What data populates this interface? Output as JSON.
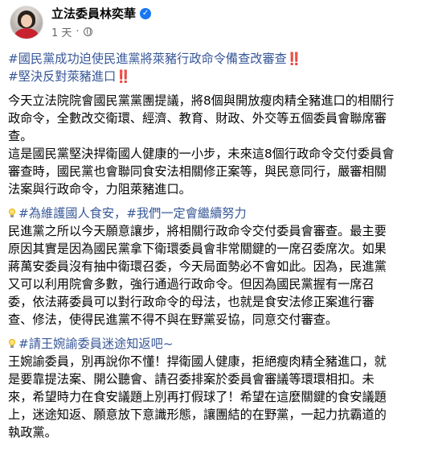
{
  "post": {
    "author": "立法委員林奕華",
    "time": "1 天",
    "dot": "·"
  },
  "content": {
    "hashtag1": "#國民黨成功迫使民進黨將萊豬行政命令備查改審查",
    "bang1": "‼️",
    "hashtag2": "#堅決反對萊豬進口",
    "bang2": "‼️",
    "p1": [
      "今天立法院院會國民黨黨團提議，將8個與開放瘦肉精全豬進口的相關行",
      "政命令，全數改交衛環、經濟、教育、財政、外交等五個委員會聯席審",
      "查。"
    ],
    "p2": [
      "這是國民黨堅決捍衛國人健康的一小步，未來這8個行政命令交付委員會",
      "審查時，國民黨也會聯同食安法相關修正案等，與民意同行，嚴審相關",
      "法案與行政命令，力阻萊豬進口。"
    ],
    "section1_tag": "#為維護國人食安，#我們一定會繼續努力",
    "p3": [
      "民進黨之所以今天願意讓步，將相關行政命令交付委員會審查。最主要",
      "原因其實是因為國民黨拿下衛環委員會非常關鍵的一席召委席次。如果",
      "蔣萬安委員沒有抽中衛環召委，今天局面勢必不會如此。因為，民進黨",
      "又可以利用院會多數，強行通過行政命令。但因為國民黨握有一席召",
      "委，依法蔣委員可以對行政命令的母法，也就是食安法修正案進行審",
      "查、修法，使得民進黨不得不與在野黨妥協，同意交付審查。"
    ],
    "section2_tag": "#請王婉諭委員迷途知返吧~",
    "p4": [
      "王婉諭委員，別再說你不懂！捍衛國人健康，拒絕瘦肉精全豬進口，就",
      "是要靠提法案、開公聽會、請召委排案於委員會審議等環環相扣。未",
      "來，希望時力在食安議題上別再打假球了！希望在這麼關鍵的食安議題",
      "上，迷途知返、願意放下意識形態，讓團結的在野黨，一起力抗霸道的",
      "執政黨。"
    ]
  }
}
